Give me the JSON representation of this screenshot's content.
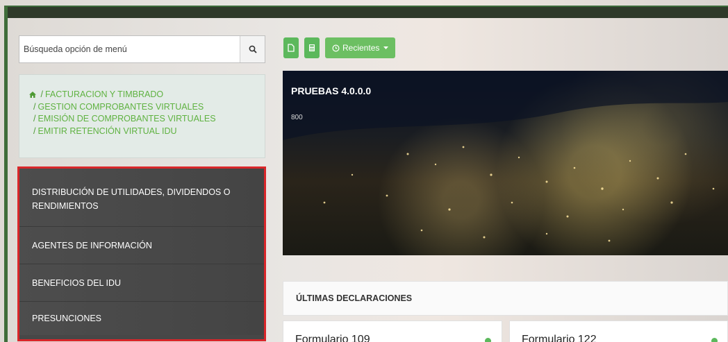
{
  "search": {
    "placeholder": "Búsqueda opción de menú"
  },
  "breadcrumb": [
    {
      "label": "FACTURACION Y TIMBRADO"
    },
    {
      "label": "GESTION COMPROBANTES VIRTUALES"
    },
    {
      "label": "EMISIÓN DE COMPROBANTES VIRTUALES"
    },
    {
      "label": "EMITIR RETENCIÓN VIRTUAL IDU"
    }
  ],
  "menu": [
    {
      "label_line1": "DISTRIBUCIÓN DE UTILIDADES, DIVIDENDOS O",
      "label_line2": "RENDIMIENTOS"
    },
    {
      "label": "AGENTES DE INFORMACIÓN"
    },
    {
      "label": "BENEFICIOS DEL IDU"
    },
    {
      "label": "PRESUNCIONES"
    }
  ],
  "toolbar": {
    "recents_label": "Recientes"
  },
  "banner": {
    "title": "PRUEBAS 4.0.0.0",
    "subtitle": "800"
  },
  "declarations": {
    "header": "ÚLTIMAS DECLARACIONES",
    "cards": [
      {
        "title": "Formulario 109"
      },
      {
        "title": "Formulario 122"
      }
    ]
  },
  "colors": {
    "accent_green": "#5cb85c",
    "highlight_red": "#d9262a",
    "menu_bg": "#474747"
  }
}
